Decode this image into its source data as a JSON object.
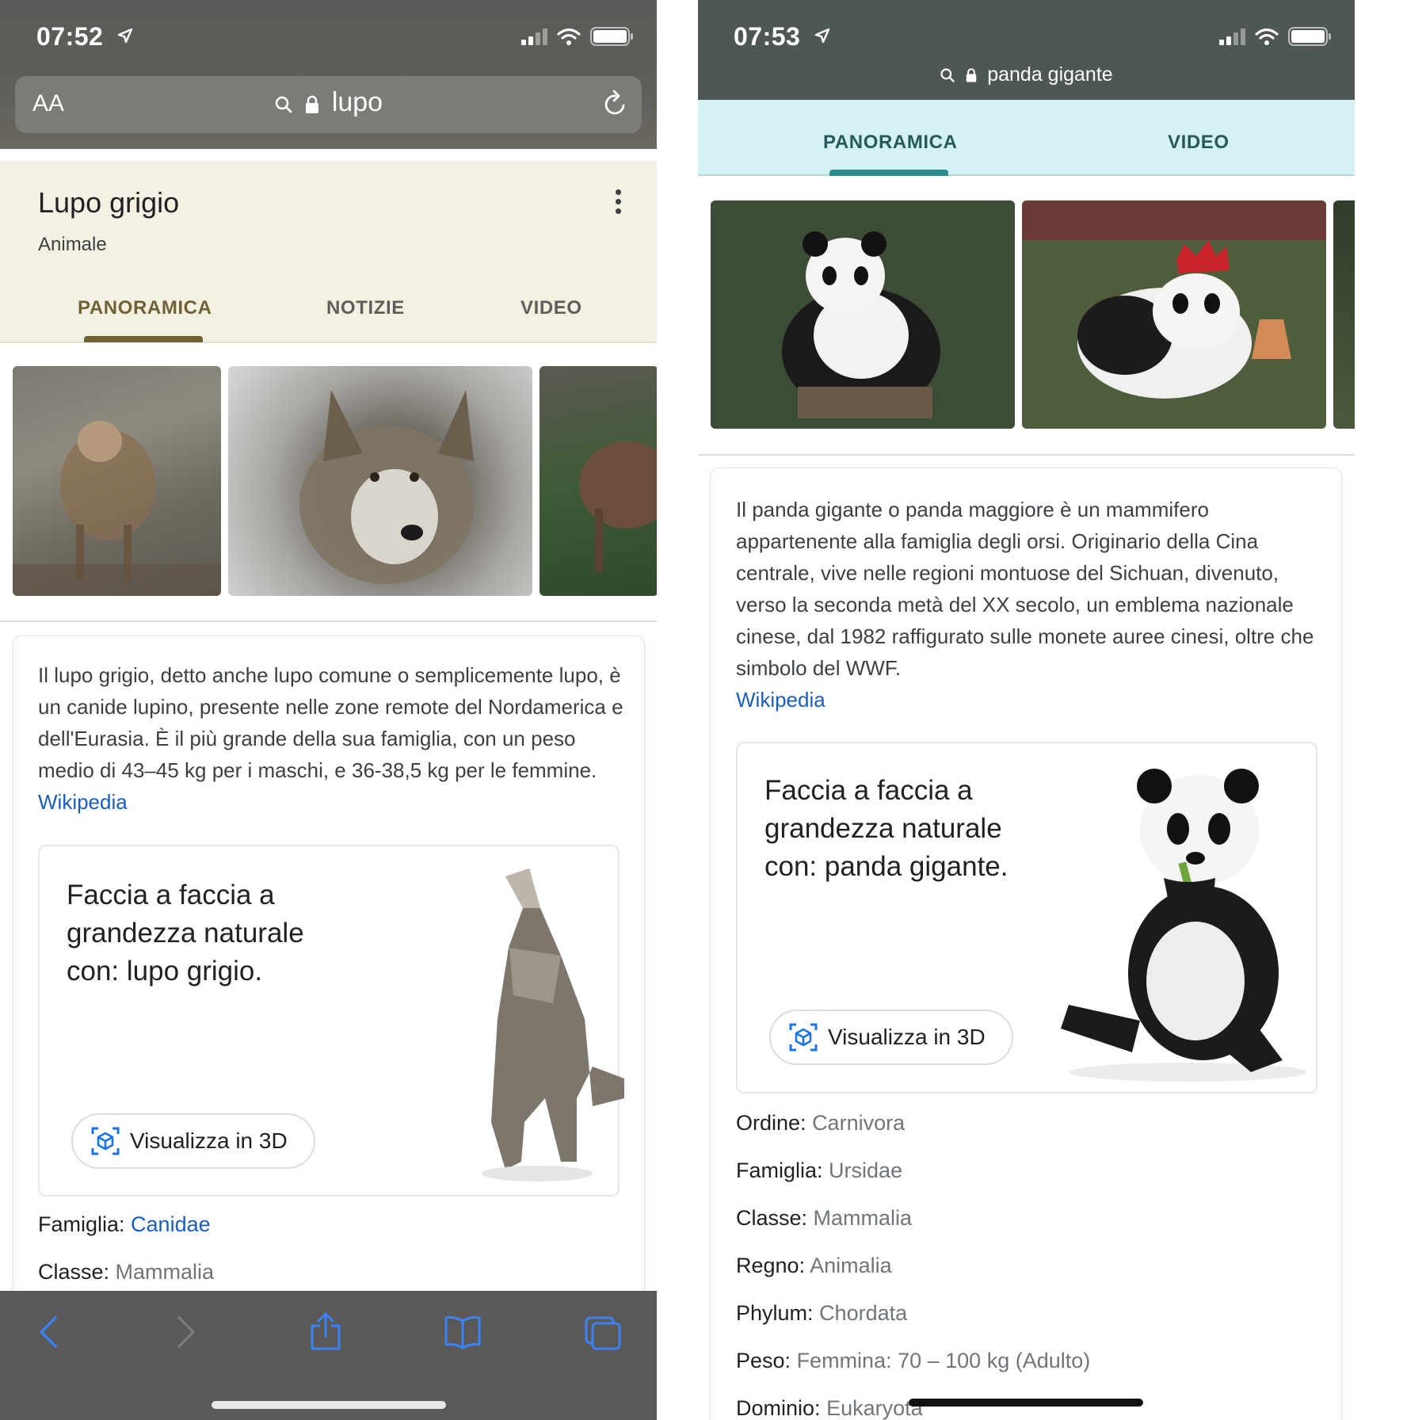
{
  "left": {
    "status": {
      "time": "07:52"
    },
    "url_bar": {
      "text_size_label": "AA",
      "query": "lupo"
    },
    "knowledge_panel": {
      "title": "Lupo grigio",
      "subtitle": "Animale",
      "tabs": [
        {
          "label": "PANORAMICA",
          "active": true
        },
        {
          "label": "NOTIZIE",
          "active": false
        },
        {
          "label": "VIDEO",
          "active": false
        }
      ]
    },
    "description": "Il lupo grigio, detto anche lupo comune o semplicemente lupo, è un canide lupino, presente nelle zone remote del Nordamerica e dell'Eurasia. È il più grande della sua famiglia, con un peso medio di 43–45 kg per i maschi, e 36-38,5 kg per le femmine.",
    "source_link": "Wikipedia",
    "ar_card": {
      "title": "Faccia a faccia a grandezza naturale con: lupo grigio.",
      "button_label": "Visualizza in 3D"
    },
    "facts": [
      {
        "label": "Famiglia:",
        "value": "Canidae"
      },
      {
        "label": "Classe:",
        "value": "Mammalia"
      }
    ]
  },
  "right": {
    "status": {
      "time": "07:53"
    },
    "url_bar": {
      "query": "panda gigante"
    },
    "tabs": [
      {
        "label": "PANORAMICA",
        "active": true
      },
      {
        "label": "VIDEO",
        "active": false
      }
    ],
    "description": "Il panda gigante o panda maggiore è un mammifero appartenente alla famiglia degli orsi. Originario della Cina centrale, vive nelle regioni montuose del Sichuan, divenuto, verso la seconda metà del XX secolo, un emblema nazionale cinese, dal 1982 raffigurato sulle monete auree cinesi, oltre che simbolo del WWF.",
    "source_link": "Wikipedia",
    "ar_card": {
      "title": "Faccia a faccia a grandezza naturale con: panda gigante.",
      "button_label": "Visualizza in 3D"
    },
    "facts": [
      {
        "label": "Ordine:",
        "value": "Carnivora"
      },
      {
        "label": "Famiglia:",
        "value": "Ursidae"
      },
      {
        "label": "Classe:",
        "value": "Mammalia"
      },
      {
        "label": "Regno:",
        "value": "Animalia"
      },
      {
        "label": "Phylum:",
        "value": "Chordata"
      },
      {
        "label": "Peso:",
        "value": "Femmina: 70 – 100 kg (Adulto)"
      },
      {
        "label": "Dominio:",
        "value": "Eukaryota"
      }
    ]
  },
  "colors": {
    "link_blue": "#1a5dbb",
    "left_tab_accent": "#6e6234",
    "right_tab_accent": "#2f8a8e",
    "right_tab_bg": "#d4f2f3",
    "left_header_bg": "#f4f1e3"
  },
  "icons": [
    "location-arrow-icon",
    "signal-icon",
    "wifi-icon",
    "battery-icon",
    "search-icon",
    "lock-icon",
    "reload-icon",
    "kebab-menu-icon",
    "ar-cube-icon",
    "back-icon",
    "forward-icon",
    "share-icon",
    "bookmarks-icon",
    "tabs-icon"
  ]
}
